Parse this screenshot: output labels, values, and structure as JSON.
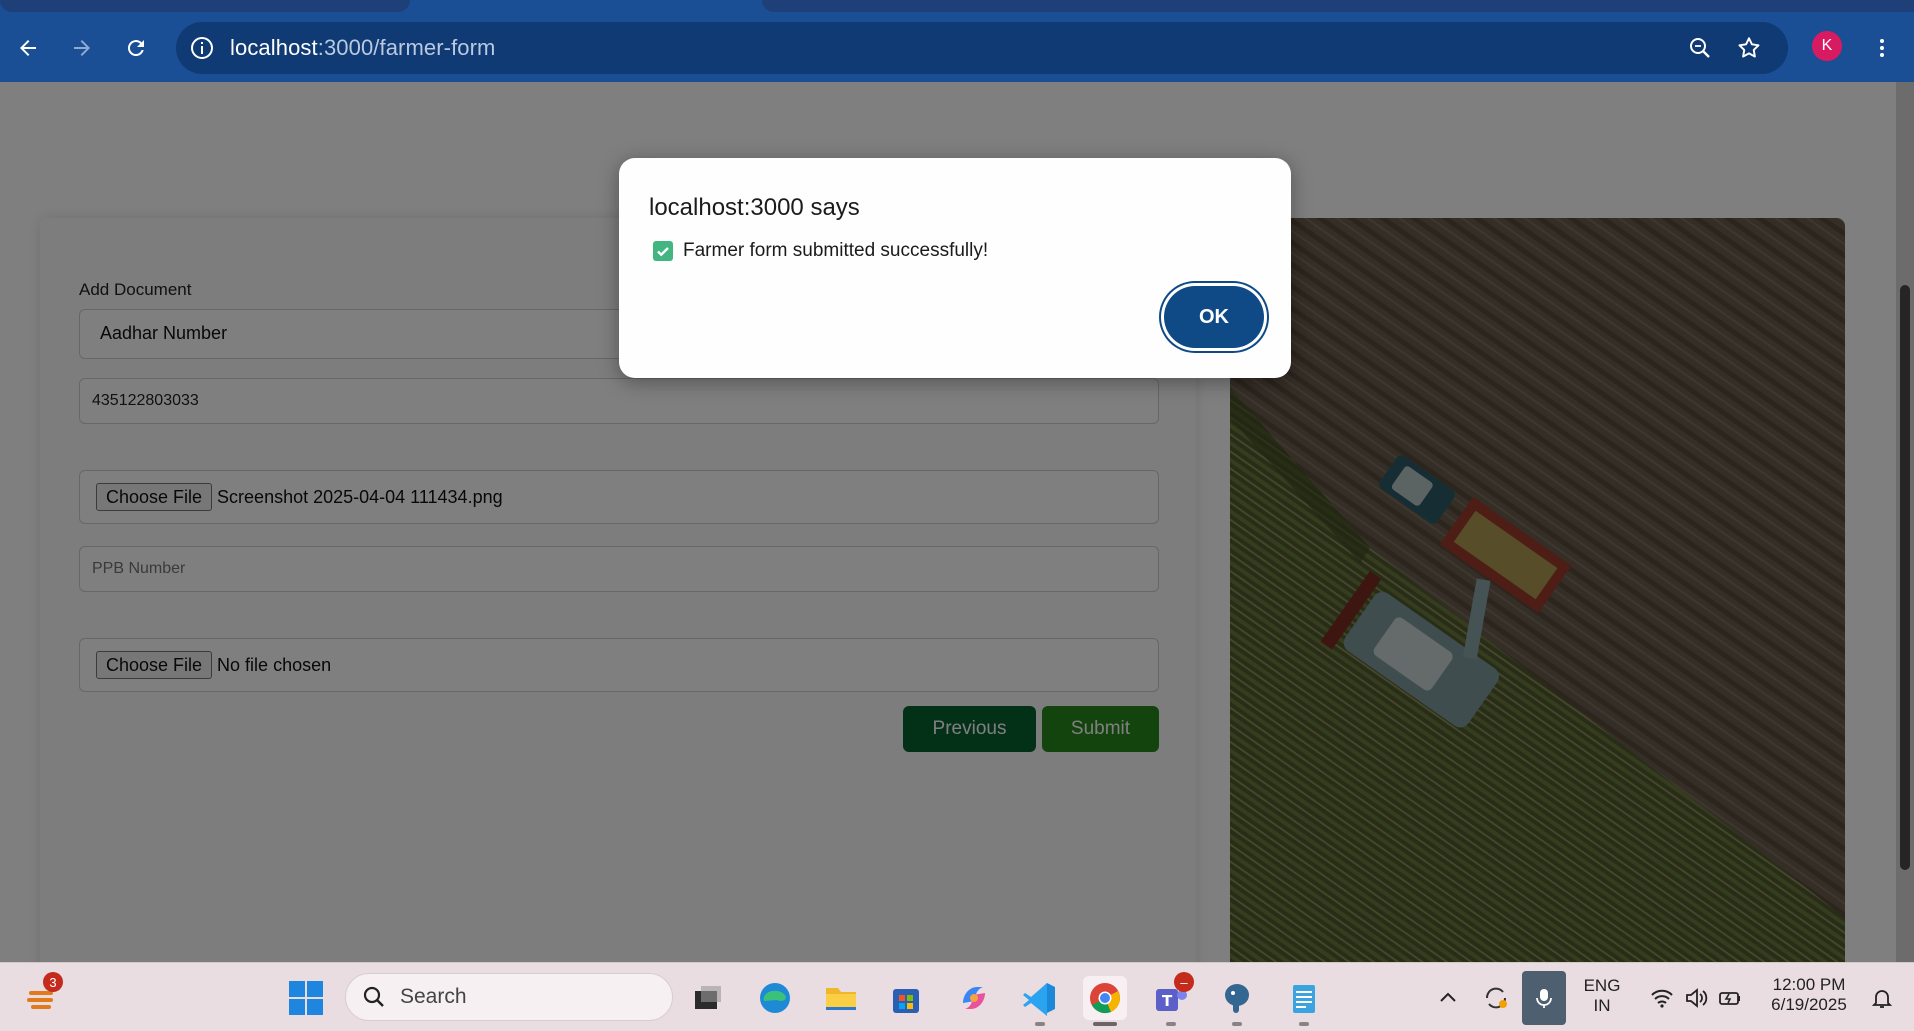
{
  "browser": {
    "url_host": "localhost",
    "url_path": ":3000/farmer-form",
    "profile_initial": "K"
  },
  "form": {
    "add_document_label": "Add Document",
    "document_type_selected": "Aadhar Number",
    "aadhar_value": "435122803033",
    "choose_file_label": "Choose File",
    "file_1_name": "Screenshot 2025-04-04 111434.png",
    "ppb_placeholder": "PPB Number",
    "file_2_name": "No file chosen",
    "previous_label": "Previous",
    "submit_label": "Submit"
  },
  "dialog": {
    "title": "localhost:3000 says",
    "message": "Farmer form submitted successfully!",
    "ok_label": "OK"
  },
  "taskbar": {
    "search_label": "Search",
    "widgets_badge": "3",
    "language_line1": "ENG",
    "language_line2": "IN",
    "time": "12:00 PM",
    "date": "6/19/2025"
  },
  "colors": {
    "chrome_blue": "#1a4f96",
    "previous_green": "#07632f",
    "submit_green": "#27881a",
    "ok_blue": "#0f4a86",
    "profile_pink": "#d81b60"
  }
}
